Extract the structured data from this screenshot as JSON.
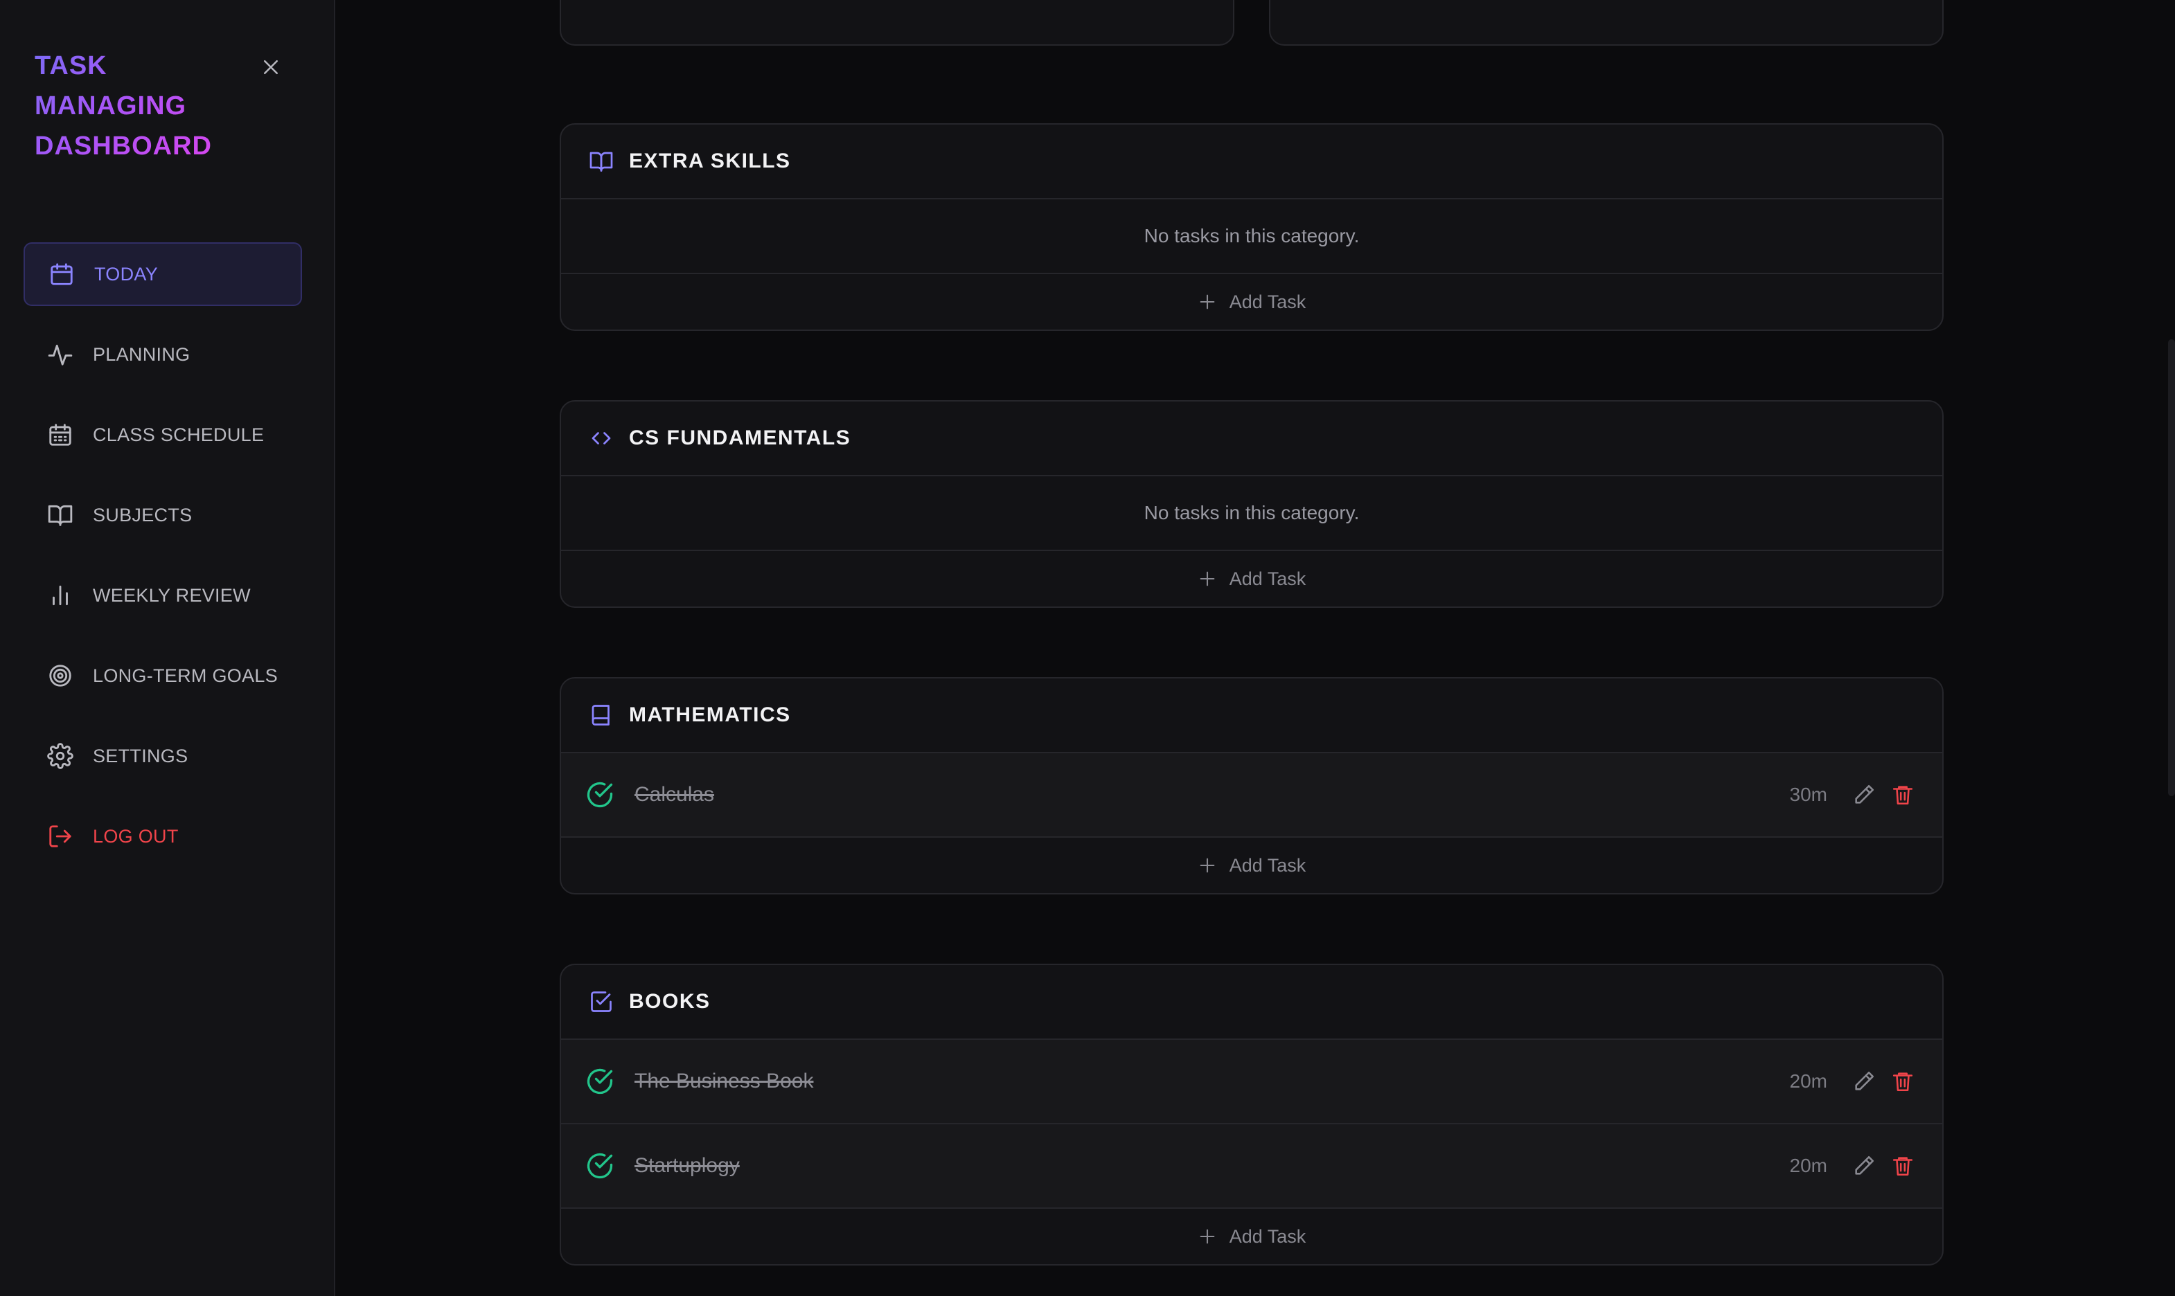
{
  "brand": {
    "line1": "TASK",
    "line2": "MANAGING",
    "line3": "DASHBOARD"
  },
  "sidebar": {
    "items": [
      {
        "label": "TODAY",
        "icon": "calendar-icon",
        "active": true
      },
      {
        "label": "PLANNING",
        "icon": "activity-icon"
      },
      {
        "label": "CLASS SCHEDULE",
        "icon": "calendar-grid-icon"
      },
      {
        "label": "SUBJECTS",
        "icon": "book-open-icon"
      },
      {
        "label": "WEEKLY REVIEW",
        "icon": "bar-chart-icon"
      },
      {
        "label": "LONG-TERM GOALS",
        "icon": "target-icon"
      },
      {
        "label": "SETTINGS",
        "icon": "gear-icon"
      }
    ],
    "logout": {
      "label": "LOG OUT",
      "icon": "logout-icon"
    }
  },
  "categories": [
    {
      "title": "EXTRA SKILLS",
      "icon": "book-open-icon",
      "empty_text": "No tasks in this category.",
      "tasks": [],
      "add_label": "Add Task"
    },
    {
      "title": "CS FUNDAMENTALS",
      "icon": "code-icon",
      "empty_text": "No tasks in this category.",
      "tasks": [],
      "add_label": "Add Task"
    },
    {
      "title": "MATHEMATICS",
      "icon": "book-icon",
      "tasks": [
        {
          "name": "Calculas",
          "duration": "30m",
          "done": true
        }
      ],
      "add_label": "Add Task"
    },
    {
      "title": "BOOKS",
      "icon": "checkbox-icon",
      "tasks": [
        {
          "name": "The Business Book",
          "duration": "20m",
          "done": true
        },
        {
          "name": "Startuplogy",
          "duration": "20m",
          "done": true
        }
      ],
      "add_label": "Add Task"
    }
  ],
  "colors": {
    "accent": "#8b84ff",
    "check": "#22c58b",
    "danger": "#f0444a"
  }
}
